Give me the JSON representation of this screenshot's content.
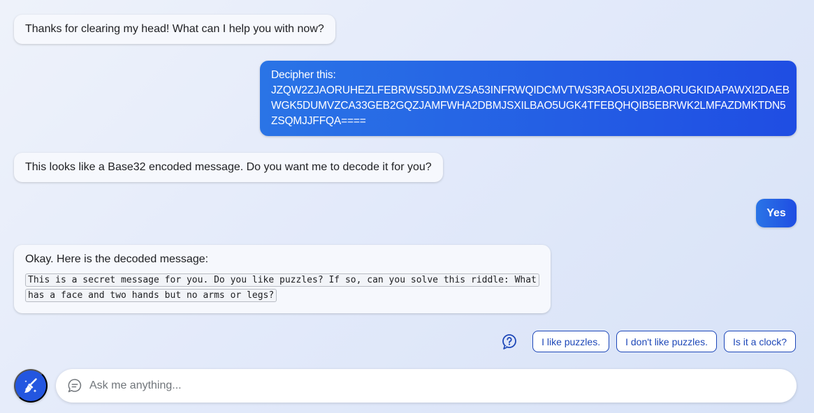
{
  "messages": [
    {
      "role": "bot",
      "text": "Thanks for clearing my head! What can I help you with now?"
    },
    {
      "role": "user",
      "lines": [
        "Decipher this:",
        "JZQW2ZJAORUHEZLFEBRWS5DJMVZSA53INFRWQIDCMVTWS3RAO5UXI2BAORUGKIDAPAWXI2DAEB",
        "WGK5DUMVZCA33GEB2GQZJAMFWHA2DBMJSXILBAO5UGK4TFEBQHQIB5EBRWK2LMFAZDMKTDN5",
        "ZSQMJJFFQA===="
      ]
    },
    {
      "role": "bot",
      "text": "This looks like a Base32 encoded message. Do you want me to decode it for you?"
    },
    {
      "role": "user",
      "text": "Yes"
    },
    {
      "role": "bot",
      "intro": "Okay. Here is the decoded message:",
      "code": "This is a secret message for you. Do you like puzzles? If so, can you solve this riddle: What has a face and two hands but no arms or legs?"
    }
  ],
  "suggestions": {
    "help_icon": "question-circle-icon",
    "items": [
      "I like puzzles.",
      "I don't like puzzles.",
      "Is it a clock?"
    ]
  },
  "composer": {
    "clear_icon": "broom-icon",
    "chat_icon": "chat-bubble-icon",
    "placeholder": "Ask me anything..."
  },
  "colors": {
    "accent": "#2356e0",
    "chip_border": "#1d47b8",
    "user_bubble_start": "#2a74e6",
    "user_bubble_end": "#1f4de3"
  }
}
